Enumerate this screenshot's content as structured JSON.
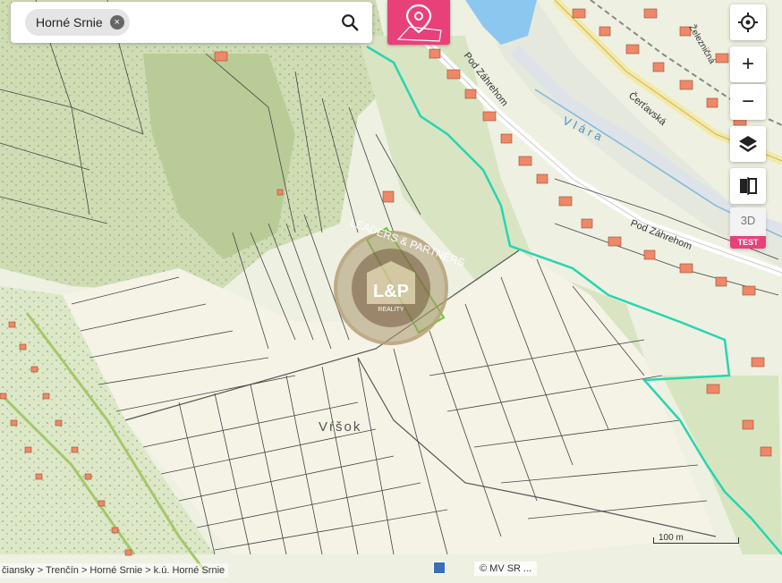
{
  "search": {
    "chip_label": "Horné Srnie",
    "chip_close": "×"
  },
  "map_labels": {
    "street_1": "Pod Záhrehom",
    "street_2": "Pod Záhrehom",
    "river": "Vlára",
    "road": "Čerťavská",
    "rail": "Železničná",
    "place": "Vŕšok"
  },
  "watermark": {
    "text": "LEADERS & PARTNERS",
    "logo": "L&P",
    "sub": "REALITY"
  },
  "controls": {
    "locate": "crosshair-icon",
    "zoom_in": "+",
    "zoom_out": "−",
    "layers": "layers-icon",
    "compare": "compare-icon",
    "mode_3d": "3D",
    "test_badge": "TEST"
  },
  "scale": "100 m",
  "breadcrumb": "čiansky > Trenčín > Horné Srnie > k.ú. Horné Srnie",
  "attribution": "© MV SR ...",
  "colors": {
    "accent": "#e8417a",
    "boundary": "#27d5b0",
    "selected_parcel": "#64c832",
    "parcel_line": "#333333",
    "building": "#ee8866",
    "river": "#7fc2ee",
    "forest": "#c7d6a9"
  }
}
